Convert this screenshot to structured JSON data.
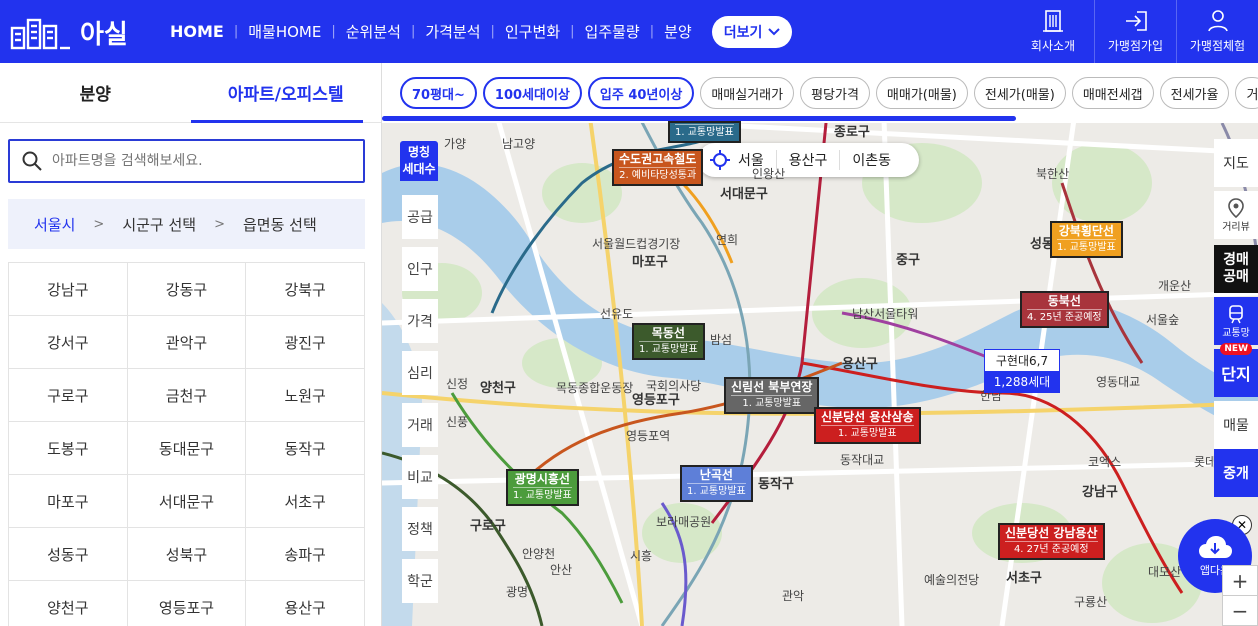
{
  "header": {
    "logo_text": "아실",
    "nav": [
      "HOME",
      "매물HOME",
      "순위분석",
      "가격분석",
      "인구변화",
      "입주물량",
      "분양"
    ],
    "more_label": "더보기",
    "right_buttons": [
      "회사소개",
      "가맹점가입",
      "가맹점체험"
    ]
  },
  "left": {
    "tabs": [
      "분양",
      "아파트/오피스텔"
    ],
    "search_placeholder": "아파트명을 검색해보세요.",
    "breadcrumb": [
      "서울시",
      "시군구 선택",
      "읍면동 선택"
    ],
    "districts": [
      "강남구",
      "강동구",
      "강북구",
      "강서구",
      "관악구",
      "광진구",
      "구로구",
      "금천구",
      "노원구",
      "도봉구",
      "동대문구",
      "동작구",
      "마포구",
      "서대문구",
      "서초구",
      "성동구",
      "성북구",
      "송파구",
      "양천구",
      "영등포구",
      "용산구"
    ]
  },
  "filters": [
    "70평대~",
    "100세대이상",
    "입주 40년이상",
    "매매실거래가",
    "평당가격",
    "매매가(매물)",
    "전세가(매물)",
    "매매전세갭",
    "전세가율",
    "거"
  ],
  "location": [
    "서울",
    "용산구",
    "이촌동"
  ],
  "map_left": {
    "top": [
      "명칭",
      "세대수"
    ],
    "items": [
      "공급",
      "인구",
      "가격",
      "심리",
      "거래",
      "비교",
      "정책",
      "학군"
    ]
  },
  "map_right": {
    "items": [
      "지도",
      "거리뷰",
      "경매공매",
      "교통망",
      "단지",
      "매물",
      "중개"
    ],
    "new_badge": "NEW"
  },
  "lines": [
    {
      "title": "수도권고속철도",
      "sub": "2. 예비타당성통과",
      "color": "#c8561e"
    },
    {
      "title": "목동선",
      "sub": "1. 교통망발표",
      "color": "#3c5a2c"
    },
    {
      "title": "신림선 북부연장",
      "sub": "1. 교통망발표",
      "color": "#666666"
    },
    {
      "title": "신분당선 용산삼송",
      "sub": "1. 교통망발표",
      "color": "#cc1f1f"
    },
    {
      "title": "광명시흥선",
      "sub": "1. 교통망발표",
      "color": "#4c9c3c"
    },
    {
      "title": "난곡선",
      "sub": "1. 교통망발표",
      "color": "#5e7fd8"
    },
    {
      "title": "강북횡단선",
      "sub": "1. 교통망발표",
      "color": "#f0a020"
    },
    {
      "title": "동북선",
      "sub": "4. 25년 준공예정",
      "color": "#a8343c"
    },
    {
      "title": "신분당선 강남용산",
      "sub": "4. 27년 준공예정",
      "color": "#cc1f1f"
    },
    {
      "title": "",
      "sub": "1. 교통망발표",
      "color": "#2a6a8a"
    }
  ],
  "apartment": {
    "name": "구현대6,7",
    "units": "1,288세대"
  },
  "places": [
    "종로구",
    "서대문구",
    "마포구",
    "중구",
    "용산구",
    "양천구",
    "영등포구",
    "동작구",
    "구로구",
    "서초구",
    "강남구",
    "성동구",
    "선유도",
    "밤섬",
    "국회의사당",
    "남산서울타워",
    "예술의전당",
    "서울월드컵경기장",
    "안산",
    "인왕산",
    "북한산",
    "개운산",
    "구룡산",
    "대모산",
    "신정",
    "영등포역",
    "동작대교",
    "보라매공원",
    "안양천",
    "신풍",
    "한남",
    "코엑스",
    "롯데월드",
    "서울숲",
    "광명",
    "시흥",
    "관악",
    "연희",
    "영동대교",
    "남고양",
    "목동종합운동장",
    "가양"
  ],
  "download_label": "앱다운",
  "zoom": [
    "+",
    "−"
  ]
}
